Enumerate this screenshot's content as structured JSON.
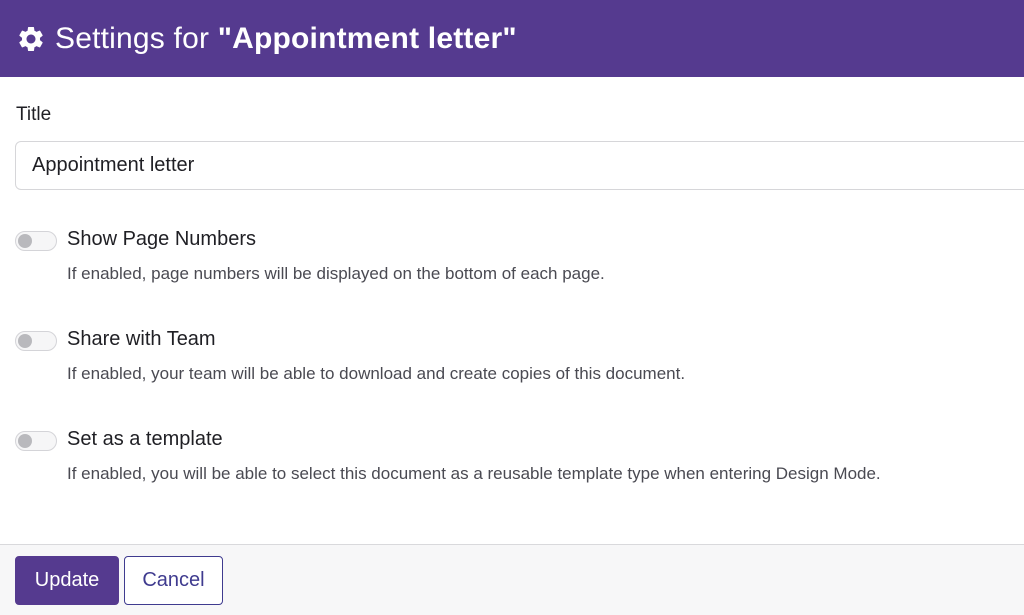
{
  "header": {
    "title_prefix": "Settings for ",
    "document_name": "\"Appointment letter\"",
    "icon": "gear-icon",
    "background_color": "#553a8f"
  },
  "title_field": {
    "label": "Title",
    "value": "Appointment letter"
  },
  "options": [
    {
      "title": "Show Page Numbers",
      "description": "If enabled, page numbers will be displayed on the bottom of each page.",
      "enabled": false
    },
    {
      "title": "Share with Team",
      "description": "If enabled, your team will be able to download and create copies of this document.",
      "enabled": false
    },
    {
      "title": "Set as a template",
      "description": "If enabled, you will be able to select this document as a reusable template type when entering Design Mode.",
      "enabled": false
    }
  ],
  "footer": {
    "update_label": "Update",
    "cancel_label": "Cancel"
  },
  "colors": {
    "accent": "#553a8f",
    "cancel_text": "#3f3b8f"
  }
}
